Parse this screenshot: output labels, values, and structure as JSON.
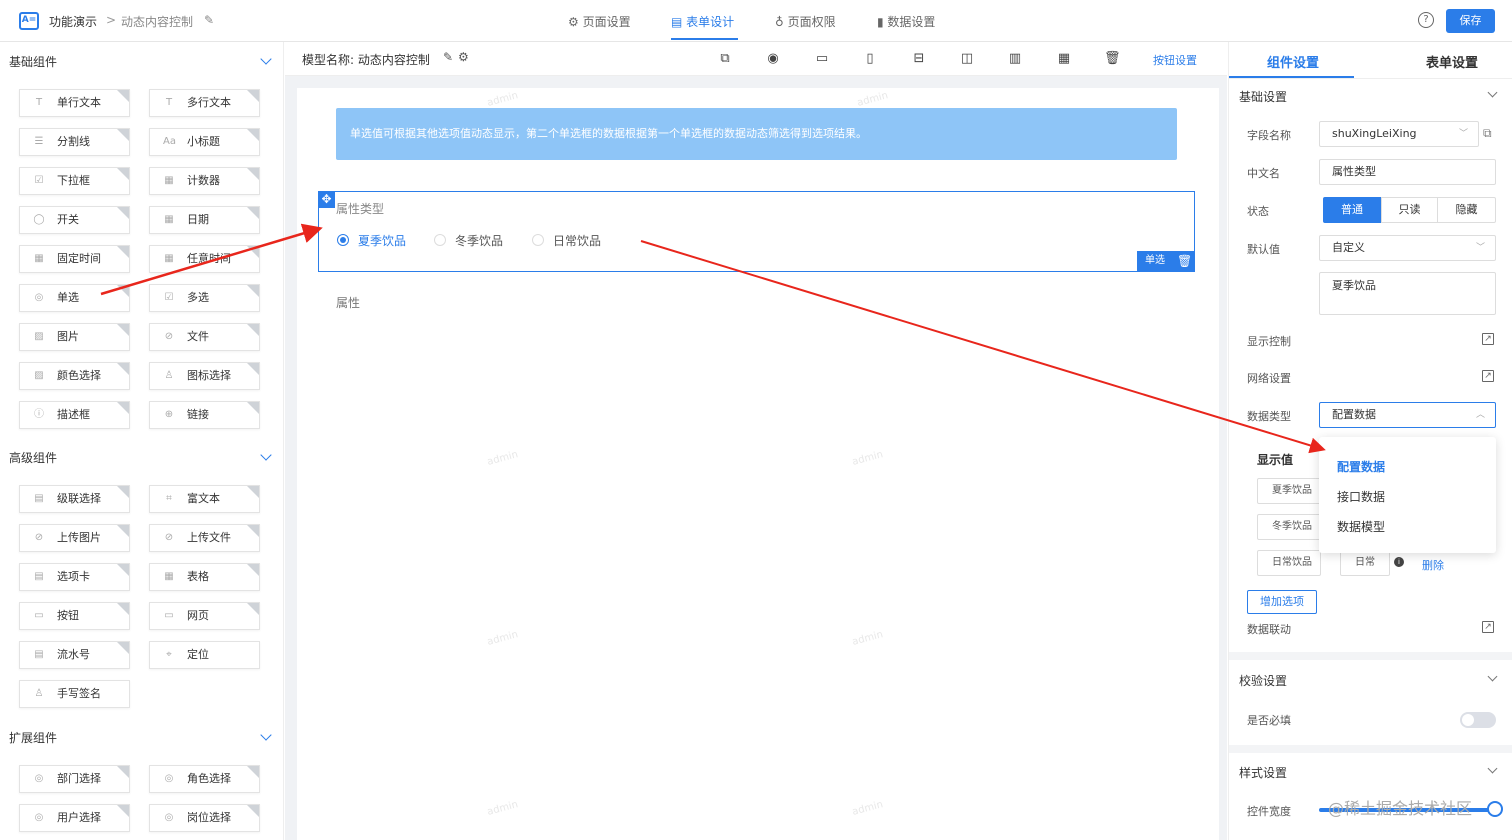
{
  "topbar": {
    "app_icon": "A=",
    "breadcrumb_root": "功能演示",
    "breadcrumb_sep": ">",
    "breadcrumb_current": "动态内容控制",
    "nav": [
      "页面设置",
      "表单设计",
      "页面权限",
      "数据设置"
    ],
    "help": "?",
    "save": "保存"
  },
  "left": {
    "basic_title": "基础组件",
    "basic_items": [
      "单行文本",
      "多行文本",
      "分割线",
      "小标题",
      "下拉框",
      "计数器",
      "开关",
      "日期",
      "固定时间",
      "任意时间",
      "单选",
      "多选",
      "图片",
      "文件",
      "颜色选择",
      "图标选择",
      "描述框",
      "链接"
    ],
    "advanced_title": "高级组件",
    "advanced_items": [
      "级联选择",
      "富文本",
      "上传图片",
      "上传文件",
      "选项卡",
      "表格",
      "按钮",
      "网页",
      "流水号",
      "定位",
      "手写签名"
    ],
    "extend_title": "扩展组件",
    "extend_items": [
      "部门选择",
      "角色选择",
      "用户选择",
      "岗位选择"
    ]
  },
  "center": {
    "model_name": "模型名称: 动态内容控制",
    "button_settings": "按钮设置",
    "banner": "单选值可根据其他选项值动态显示，第二个单选框的数据根据第一个单选框的数据动态筛选得到选项结果。",
    "field_label": "属性类型",
    "options": [
      "夏季饮品",
      "冬季饮品",
      "日常饮品"
    ],
    "field_tag": "单选",
    "field2_label": "属性",
    "watermark": "admin"
  },
  "right": {
    "tab_component": "组件设置",
    "tab_form": "表单设置",
    "basic_section": "基础设置",
    "field_name_label": "字段名称",
    "field_name_value": "shuXingLeiXing",
    "cn_name_label": "中文名",
    "cn_name_value": "属性类型",
    "status_label": "状态",
    "status_options": [
      "普通",
      "只读",
      "隐藏"
    ],
    "default_label": "默认值",
    "default_value": "自定义",
    "default_text": "夏季饮品",
    "display_control": "显示控制",
    "grid_settings": "网络设置",
    "data_type_label": "数据类型",
    "data_type_value": "配置数据",
    "display_value_header": "显示值",
    "option_inputs": [
      "夏季饮品",
      "冬季饮品",
      "日常饮品"
    ],
    "last_value": "日常",
    "delete": "删除",
    "add_option": "增加选项",
    "data_link": "数据联动",
    "validate_section": "校验设置",
    "required_label": "是否必填",
    "style_section": "样式设置",
    "width_label": "控件宽度",
    "dropdown": [
      "配置数据",
      "接口数据",
      "数据模型"
    ]
  },
  "credit": "@稀土掘金技术社区",
  "colors": {
    "accent": "#2b7de9",
    "banner": "#8ec5f7",
    "arrow": "#e8261c"
  }
}
